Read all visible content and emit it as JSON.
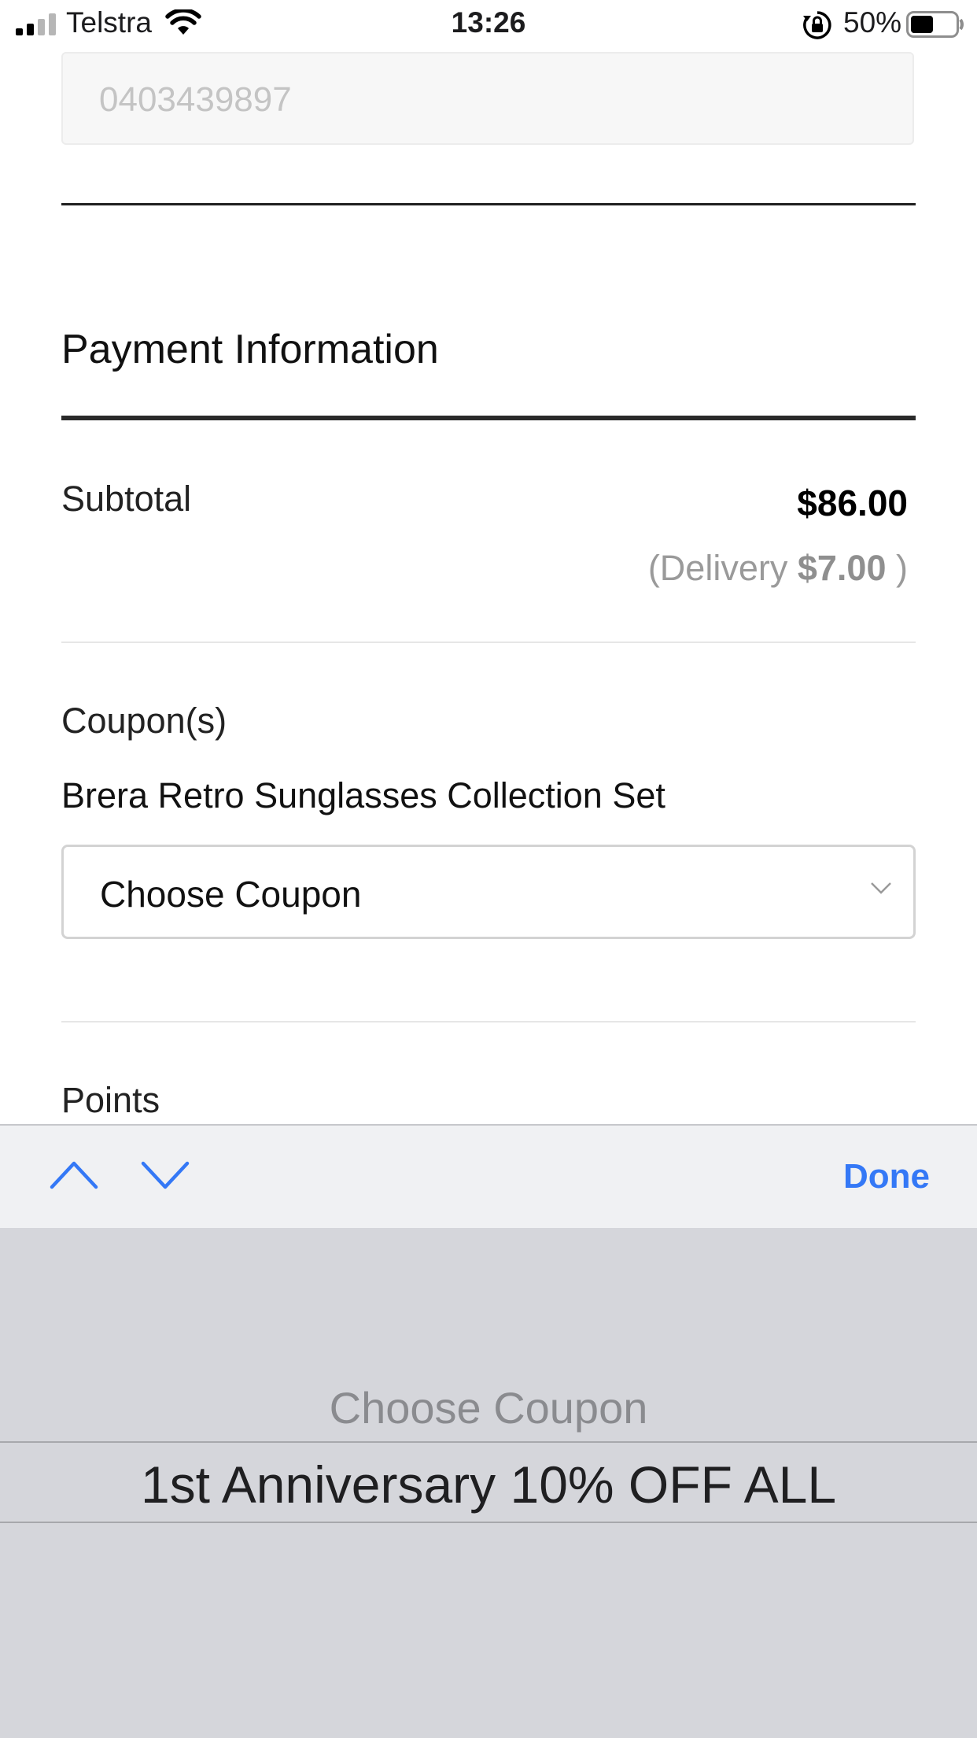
{
  "status_bar": {
    "carrier": "Telstra",
    "time": "13:26",
    "battery_percent": "50%",
    "signal_bars_active": 2,
    "signal_bars_total": 4,
    "battery_level": 0.5
  },
  "phone_field": {
    "value": "0403439897"
  },
  "payment": {
    "title": "Payment Information",
    "subtotal_label": "Subtotal",
    "subtotal_value": "$86.00",
    "delivery_prefix": "(Delivery",
    "delivery_value": "$7.00",
    "delivery_suffix": ")",
    "coupons_label": "Coupon(s)",
    "product_name": "Brera Retro Sunglasses Collection Set",
    "coupon_select_value": "Choose Coupon",
    "points_label": "Points"
  },
  "toolbar": {
    "prev_icon": "chevron-up-icon",
    "next_icon": "chevron-down-icon",
    "done_label": "Done",
    "accent_color": "#3478f6"
  },
  "picker": {
    "options": [
      "Choose Coupon",
      "1st Anniversary 10% OFF ALL"
    ],
    "selected": "1st Anniversary 10% OFF ALL"
  }
}
